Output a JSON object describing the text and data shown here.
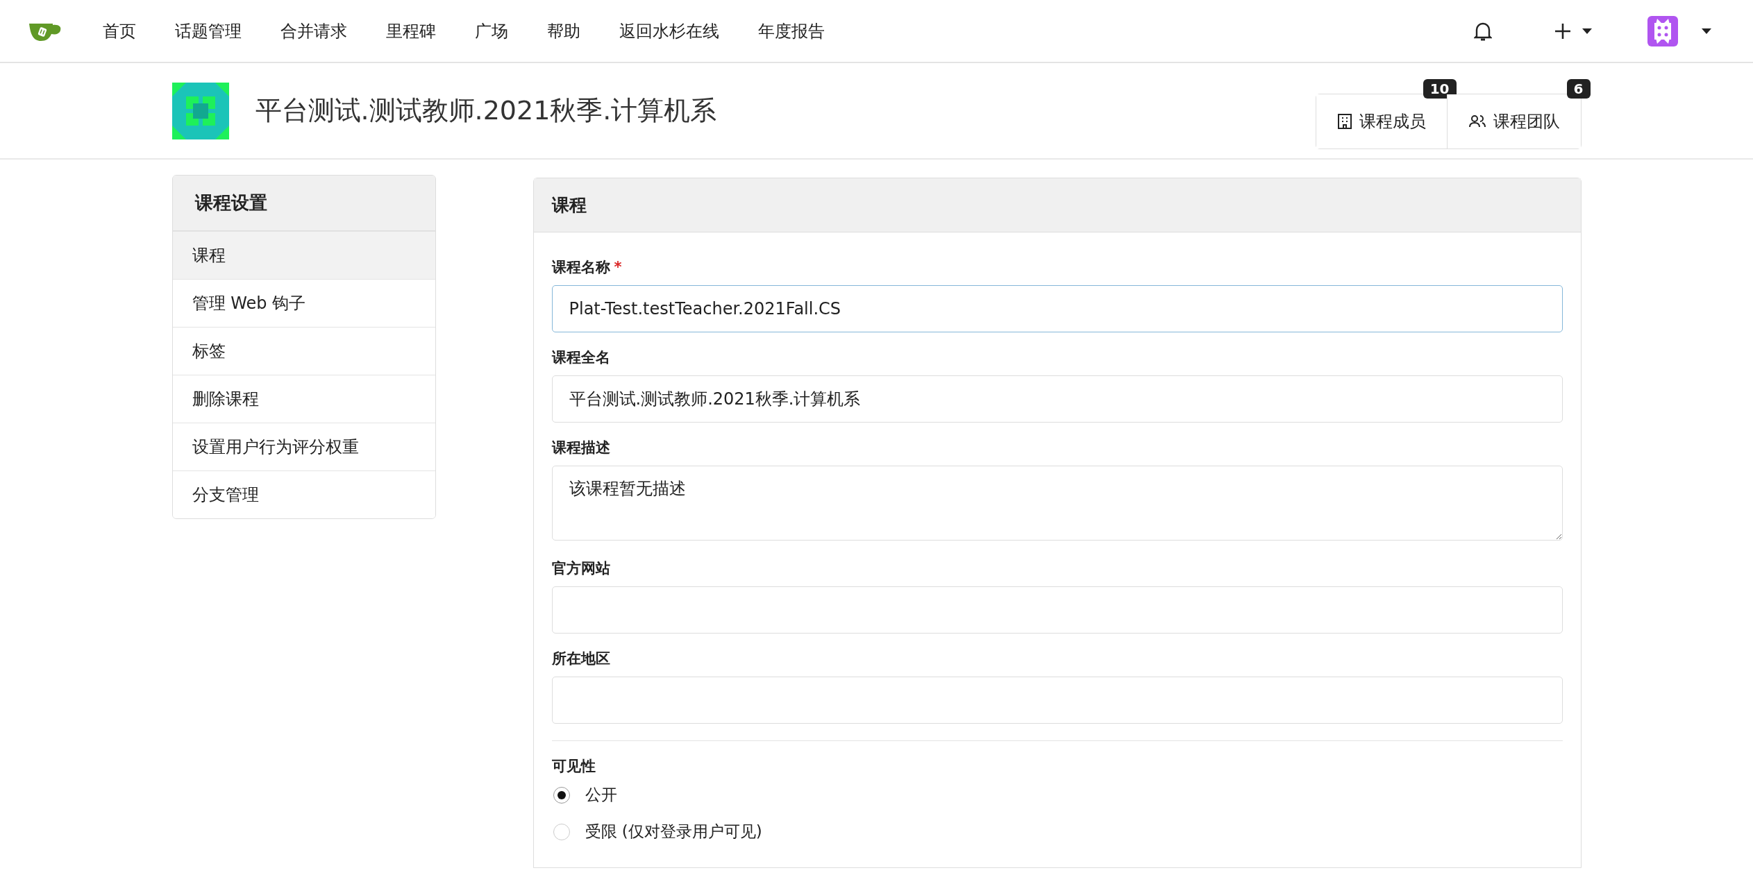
{
  "nav": {
    "items": [
      {
        "label": "首页"
      },
      {
        "label": "话题管理"
      },
      {
        "label": "合并请求"
      },
      {
        "label": "里程碑"
      },
      {
        "label": "广场"
      },
      {
        "label": "帮助"
      },
      {
        "label": "返回水杉在线"
      },
      {
        "label": "年度报告"
      }
    ]
  },
  "header": {
    "title": "平台测试.测试教师.2021秋季.计算机系",
    "buttons": [
      {
        "label": "课程成员",
        "count": "10",
        "kind": "members"
      },
      {
        "label": "课程团队",
        "count": "6",
        "kind": "team"
      }
    ]
  },
  "sidebar": {
    "title": "课程设置",
    "items": [
      {
        "label": "课程",
        "selected": true
      },
      {
        "label": "管理 Web 钩子",
        "selected": false
      },
      {
        "label": "标签",
        "selected": false
      },
      {
        "label": "删除课程",
        "selected": false
      },
      {
        "label": "设置用户行为评分权重",
        "selected": false
      },
      {
        "label": "分支管理",
        "selected": false
      }
    ]
  },
  "panel": {
    "title": "课程",
    "fields": [
      {
        "label": "课程名称",
        "required_mark": "*",
        "kind": "input",
        "value": "Plat-Test.testTeacher.2021Fall.CS",
        "focused": true
      },
      {
        "label": "课程全名",
        "kind": "input",
        "value": "平台测试.测试教师.2021秋季.计算机系",
        "focused": false
      },
      {
        "label": "课程描述",
        "kind": "textarea",
        "value": "该课程暂无描述",
        "focused": false
      },
      {
        "label": "官方网站",
        "kind": "input",
        "focused": false
      },
      {
        "label": "所在地区",
        "kind": "input",
        "focused": false
      }
    ],
    "visibility": {
      "label": "可见性",
      "options": [
        {
          "label": "公开",
          "selected": true
        },
        {
          "label": "受限 (仅对登录用户可见)",
          "selected": false
        }
      ]
    }
  }
}
